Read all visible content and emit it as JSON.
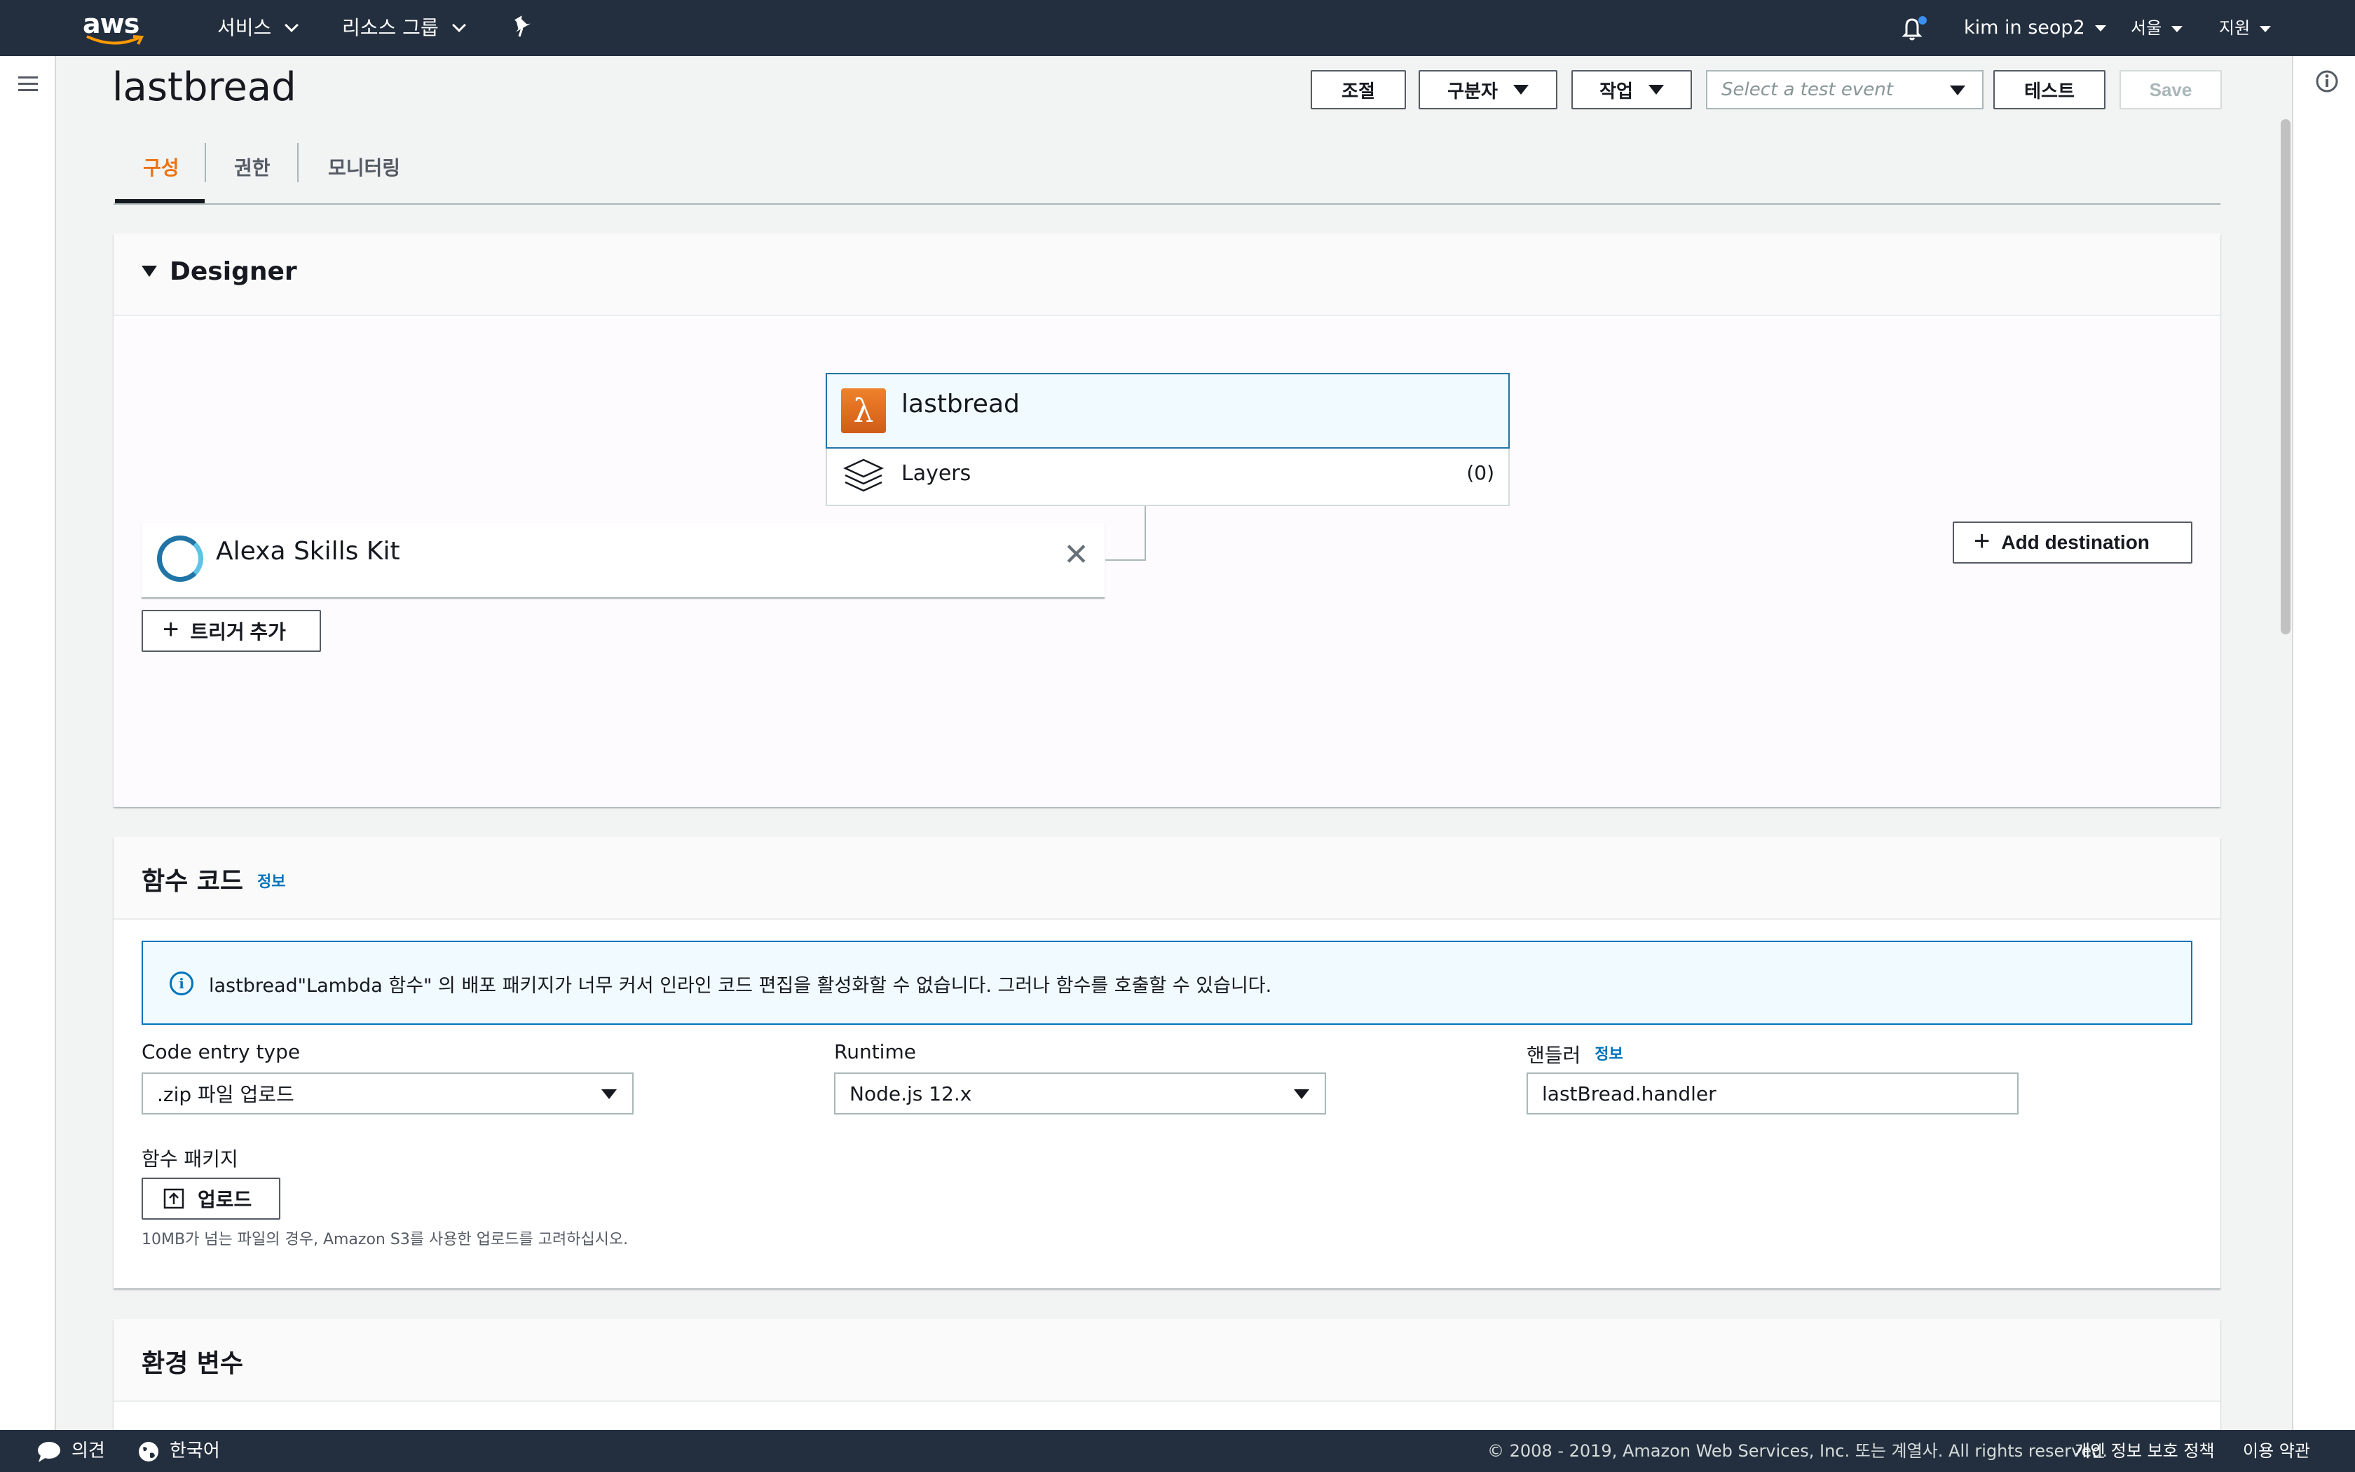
{
  "topnav": {
    "logo": "aws",
    "services": "서비스",
    "resource_groups": "리소스 그룹",
    "user": "kim in seop2",
    "region": "서울",
    "support": "지원"
  },
  "header": {
    "title": "lastbread",
    "throttle": "조절",
    "qualifiers": "구분자",
    "actions": "작업",
    "test_event_placeholder": "Select a test event",
    "test": "테스트",
    "save": "Save"
  },
  "tabs": [
    {
      "label": "구성"
    },
    {
      "label": "권한"
    },
    {
      "label": "모니터링"
    }
  ],
  "designer": {
    "title": "Designer",
    "function_name": "lastbread",
    "layers_label": "Layers",
    "layers_count": "(0)",
    "trigger_name": "Alexa Skills Kit",
    "add_trigger": "트리거 추가",
    "add_destination": "Add destination"
  },
  "function_code": {
    "title": "함수 코드",
    "info": "정보",
    "alert": "lastbread\"Lambda 함수\" 의 배포 패키지가 너무 커서 인라인 코드 편집을 활성화할 수 없습니다. 그러나 함수를 호출할 수 있습니다.",
    "code_entry_label": "Code entry type",
    "code_entry_value": ".zip 파일 업로드",
    "runtime_label": "Runtime",
    "runtime_value": "Node.js 12.x",
    "handler_label": "핸들러",
    "handler_info": "정보",
    "handler_value": "lastBread.handler",
    "package_label": "함수 패키지",
    "upload": "업로드",
    "hint": "10MB가 넘는 파일의 경우, Amazon S3를 사용한 업로드를 고려하십시오."
  },
  "env_vars": {
    "title": "환경 변수"
  },
  "footer": {
    "feedback": "의견",
    "language": "한국어",
    "copyright": "© 2008 - 2019, Amazon Web Services, Inc. 또는 계열사. All rights reserved.",
    "privacy": "개인 정보 보호 정책",
    "terms": "이용 약관"
  },
  "colors": {
    "nav_bg": "#232f3e",
    "accent": "#ec7211",
    "link": "#0073bb"
  }
}
